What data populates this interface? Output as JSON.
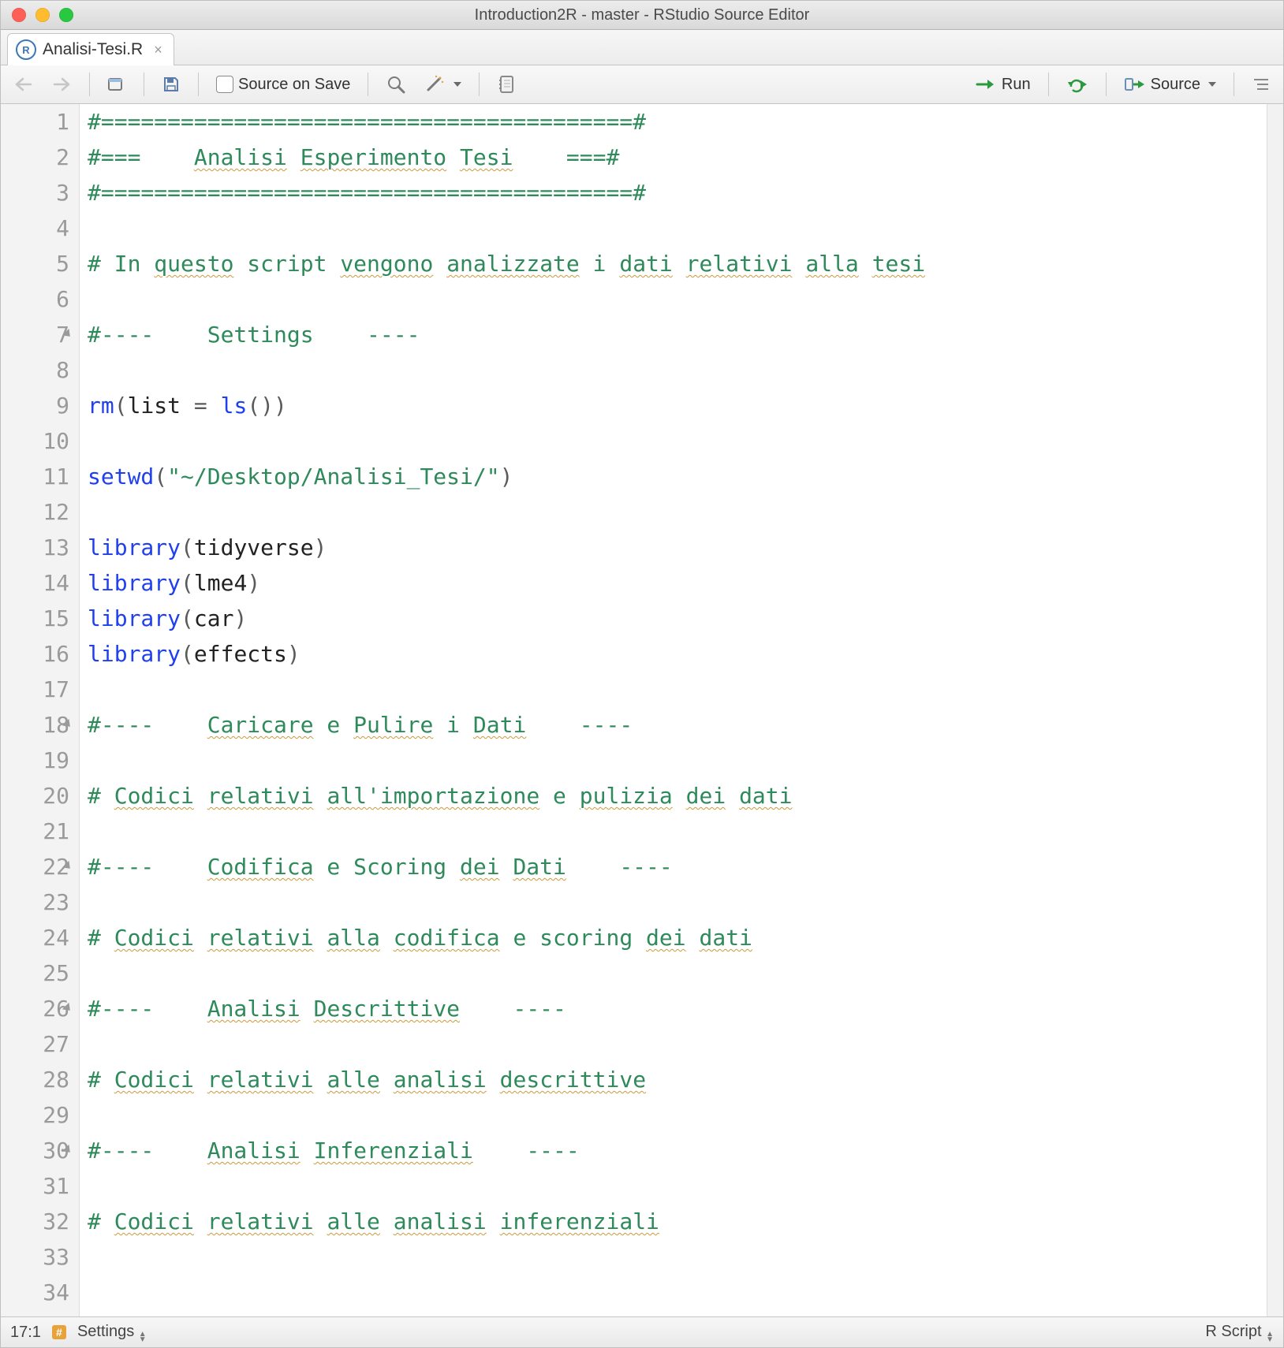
{
  "window": {
    "title": "Introduction2R - master - RStudio Source Editor"
  },
  "tab": {
    "filename": "Analisi-Tesi.R",
    "icon_letter": "R"
  },
  "toolbar": {
    "source_on_save_label": "Source on Save",
    "run_label": "Run",
    "source_label": "Source"
  },
  "code": {
    "lines": [
      {
        "n": 1,
        "type": "comment",
        "text": "#========================================#"
      },
      {
        "n": 2,
        "type": "comment",
        "text": "#===    Analisi Esperimento Tesi    ===#",
        "squiggles": [
          "Analisi",
          "Esperimento",
          "Tesi"
        ]
      },
      {
        "n": 3,
        "type": "comment",
        "text": "#========================================#"
      },
      {
        "n": 4,
        "type": "blank",
        "text": ""
      },
      {
        "n": 5,
        "type": "comment",
        "text": "# In questo script vengono analizzate i dati relativi alla tesi",
        "squiggles": [
          "questo",
          "vengono",
          "analizzate",
          "dati",
          "relativi",
          "alla",
          "tesi"
        ]
      },
      {
        "n": 6,
        "type": "blank",
        "text": ""
      },
      {
        "n": 7,
        "type": "comment",
        "text": "#----    Settings    ----",
        "fold": true
      },
      {
        "n": 8,
        "type": "blank",
        "text": ""
      },
      {
        "n": 9,
        "type": "code",
        "call": "rm",
        "inner_pre": "list ",
        "op": "=",
        "inner_mid": " ",
        "inner_call": "ls",
        "inner_args": ""
      },
      {
        "n": 10,
        "type": "blank",
        "text": ""
      },
      {
        "n": 11,
        "type": "code",
        "call": "setwd",
        "string_arg": "\"~/Desktop/Analisi_Tesi/\""
      },
      {
        "n": 12,
        "type": "blank",
        "text": ""
      },
      {
        "n": 13,
        "type": "code",
        "call": "library",
        "plain_arg": "tidyverse"
      },
      {
        "n": 14,
        "type": "code",
        "call": "library",
        "plain_arg": "lme4"
      },
      {
        "n": 15,
        "type": "code",
        "call": "library",
        "plain_arg": "car"
      },
      {
        "n": 16,
        "type": "code",
        "call": "library",
        "plain_arg": "effects"
      },
      {
        "n": 17,
        "type": "blank",
        "text": ""
      },
      {
        "n": 18,
        "type": "comment",
        "text": "#----    Caricare e Pulire i Dati    ----",
        "fold": true,
        "squiggles": [
          "Caricare",
          "Pulire",
          "Dati"
        ]
      },
      {
        "n": 19,
        "type": "blank",
        "text": ""
      },
      {
        "n": 20,
        "type": "comment",
        "text": "# Codici relativi all'importazione e pulizia dei dati",
        "squiggles": [
          "Codici",
          "relativi",
          "all'importazione",
          "pulizia",
          "dei",
          "dati"
        ]
      },
      {
        "n": 21,
        "type": "blank",
        "text": ""
      },
      {
        "n": 22,
        "type": "comment",
        "text": "#----    Codifica e Scoring dei Dati    ----",
        "fold": true,
        "squiggles": [
          "Codifica",
          "dei",
          "Dati"
        ]
      },
      {
        "n": 23,
        "type": "blank",
        "text": ""
      },
      {
        "n": 24,
        "type": "comment",
        "text": "# Codici relativi alla codifica e scoring dei dati",
        "squiggles": [
          "Codici",
          "relativi",
          "alla",
          "codifica",
          "dei",
          "dati"
        ]
      },
      {
        "n": 25,
        "type": "blank",
        "text": ""
      },
      {
        "n": 26,
        "type": "comment",
        "text": "#----    Analisi Descrittive    ----",
        "fold": true,
        "squiggles": [
          "Analisi",
          "Descrittive"
        ]
      },
      {
        "n": 27,
        "type": "blank",
        "text": ""
      },
      {
        "n": 28,
        "type": "comment",
        "text": "# Codici relativi alle analisi descrittive",
        "squiggles": [
          "Codici",
          "relativi",
          "alle",
          "analisi",
          "descrittive"
        ]
      },
      {
        "n": 29,
        "type": "blank",
        "text": ""
      },
      {
        "n": 30,
        "type": "comment",
        "text": "#----    Analisi Inferenziali    ----",
        "fold": true,
        "squiggles": [
          "Analisi",
          "Inferenziali"
        ]
      },
      {
        "n": 31,
        "type": "blank",
        "text": ""
      },
      {
        "n": 32,
        "type": "comment",
        "text": "# Codici relativi alle analisi inferenziali",
        "squiggles": [
          "Codici",
          "relativi",
          "alle",
          "analisi",
          "inferenziali"
        ]
      },
      {
        "n": 33,
        "type": "blank",
        "text": ""
      },
      {
        "n": 34,
        "type": "blank",
        "text": ""
      }
    ]
  },
  "statusbar": {
    "cursor": "17:1",
    "section": "Settings",
    "lang": "R Script"
  }
}
